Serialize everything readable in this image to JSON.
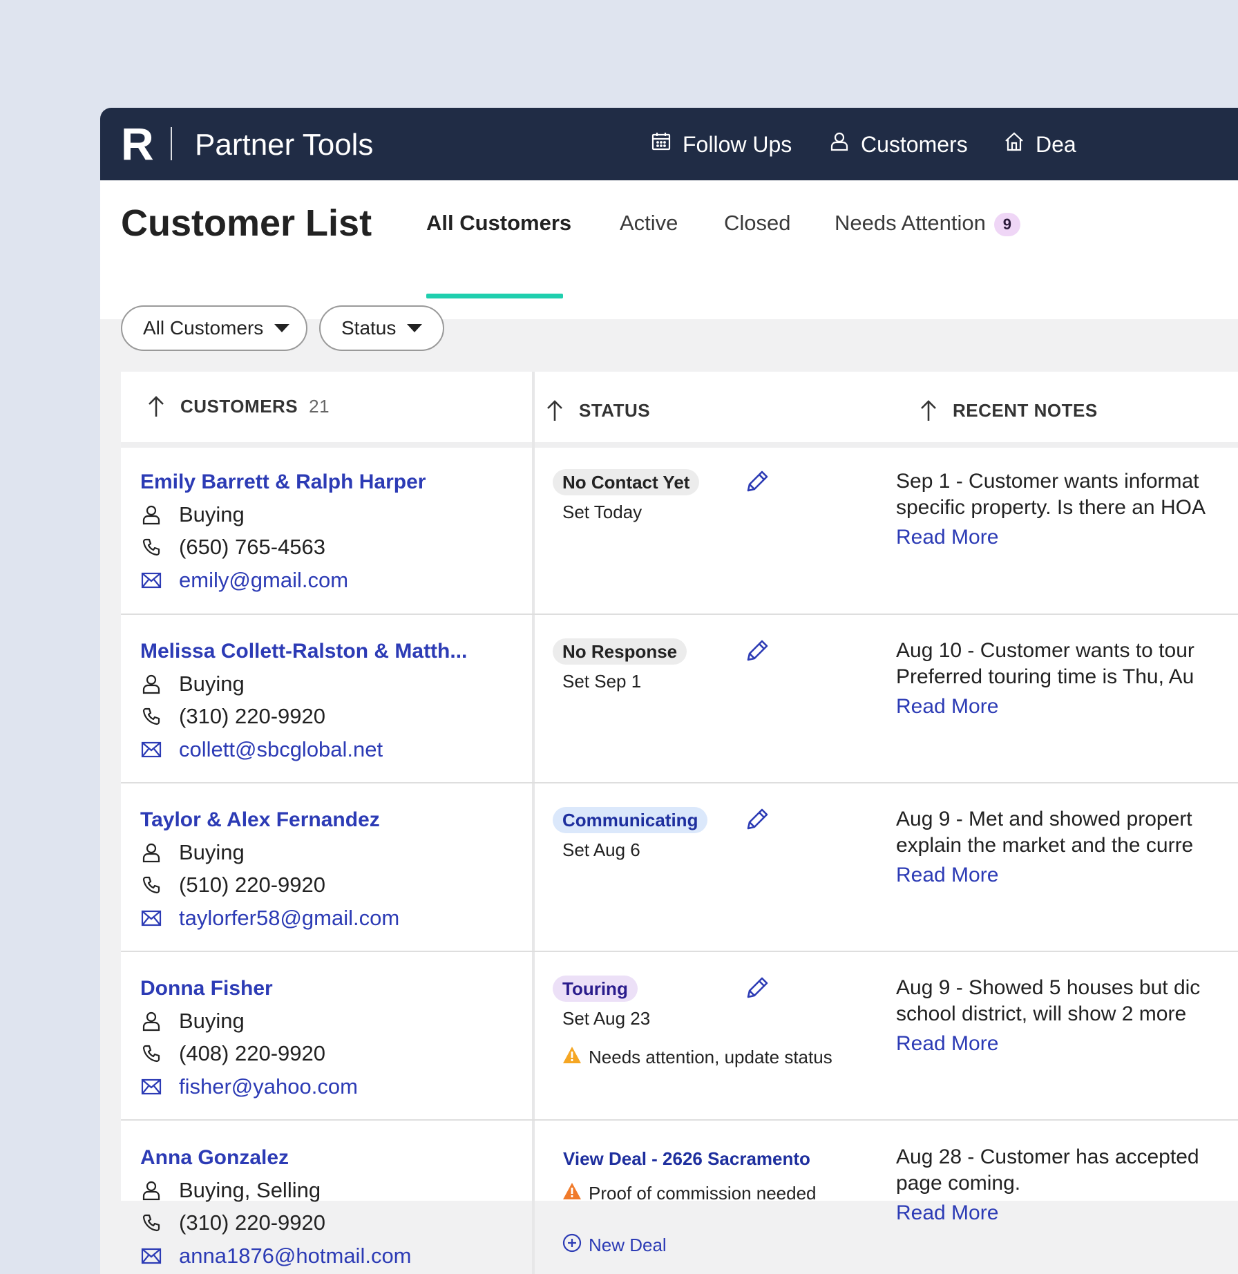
{
  "header": {
    "logo": "R",
    "app_title": "Partner Tools",
    "nav": [
      {
        "label": "Follow Ups",
        "icon": "calendar-icon"
      },
      {
        "label": "Customers",
        "icon": "user-icon"
      },
      {
        "label": "Dea",
        "icon": "home-icon"
      }
    ]
  },
  "page": {
    "title": "Customer List",
    "tabs": [
      {
        "label": "All Customers"
      },
      {
        "label": "Active"
      },
      {
        "label": "Closed"
      },
      {
        "label": "Needs Attention",
        "badge": "9"
      }
    ]
  },
  "filters": {
    "customers": "All Customers",
    "status": "Status"
  },
  "table": {
    "headers": {
      "customers": "CUSTOMERS",
      "customers_count": "21",
      "status": "STATUS",
      "notes": "RECENT NOTES"
    },
    "rows": [
      {
        "name": "Emily Barrett & Ralph Harper",
        "type": "Buying",
        "phone": "(650) 765-4563",
        "email": "emily@gmail.com",
        "status": "No Contact Yet",
        "set": "Set Today",
        "note1": "Sep 1 - Customer wants informat",
        "note2": "specific property. Is there an HOA",
        "read_more": "Read More"
      },
      {
        "name": "Melissa Collett-Ralston & Matth...",
        "type": "Buying",
        "phone": "(310) 220-9920",
        "email": "collett@sbcglobal.net",
        "status": "No Response",
        "set": "Set Sep 1",
        "note1": "Aug 10 - Customer wants to tour",
        "note2": "Preferred touring time is Thu, Au",
        "read_more": "Read More"
      },
      {
        "name": "Taylor & Alex Fernandez",
        "type": "Buying",
        "phone": "(510) 220-9920",
        "email": "taylorfer58@gmail.com",
        "status": "Communicating",
        "set": "Set Aug 6",
        "note1": "Aug 9 - Met and showed propert",
        "note2": "explain the market and the curre",
        "read_more": "Read More"
      },
      {
        "name": "Donna Fisher",
        "type": "Buying",
        "phone": "(408) 220-9920",
        "email": "fisher@yahoo.com",
        "status": "Touring",
        "set": "Set Aug 23",
        "warning": "Needs attention, update status",
        "note1": "Aug 9 - Showed 5 houses but dic",
        "note2": "school district, will show 2 more",
        "read_more": "Read More"
      },
      {
        "name": "Anna Gonzalez",
        "type": "Buying, Selling",
        "phone": "(310) 220-9920",
        "email": "anna1876@hotmail.com",
        "deal_link": "View Deal - 2626 Sacramento",
        "warning": "Proof of commission needed",
        "new_deal": "New Deal",
        "note1": "Aug 28 - Customer has accepted",
        "note2": "page coming.",
        "read_more": "Read More"
      }
    ]
  },
  "colors": {
    "nav_bg": "#202c45",
    "accent_tab": "#1fcfae",
    "link": "#2c3bb5",
    "warning": "#f5a623"
  }
}
